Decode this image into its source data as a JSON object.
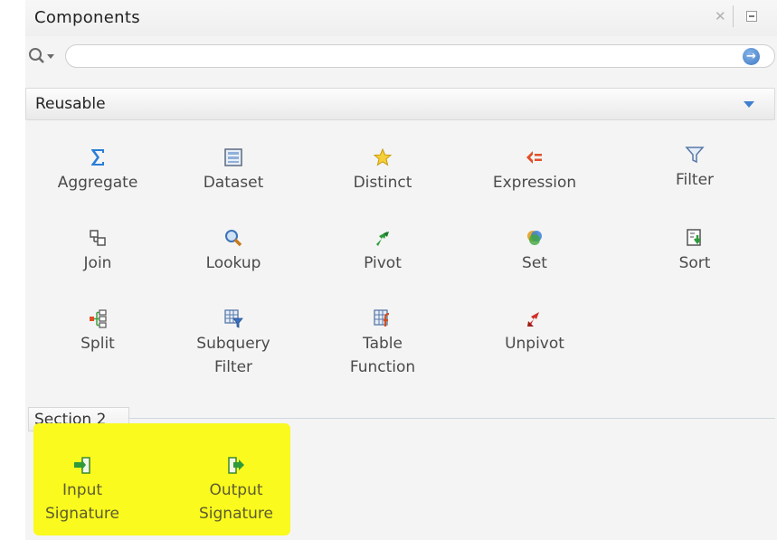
{
  "panel": {
    "title": "Components"
  },
  "search": {
    "placeholder": "",
    "value": ""
  },
  "dropdown": {
    "selected": "Reusable"
  },
  "components": [
    {
      "label": "Aggregate",
      "icon": "sigma-icon"
    },
    {
      "label": "Dataset",
      "icon": "dataset-icon"
    },
    {
      "label": "Distinct",
      "icon": "star-icon"
    },
    {
      "label": "Expression",
      "icon": "expression-icon"
    },
    {
      "label": "Filter",
      "icon": "filter-funnel-icon"
    },
    {
      "label": "Join",
      "icon": "join-icon"
    },
    {
      "label": "Lookup",
      "icon": "magnifier-icon"
    },
    {
      "label": "Pivot",
      "icon": "pivot-arrows-icon"
    },
    {
      "label": "Set",
      "icon": "set-circles-icon"
    },
    {
      "label": "Sort",
      "icon": "sort-icon"
    },
    {
      "label": "Split",
      "icon": "split-icon"
    },
    {
      "label_line1": "Subquery",
      "label_line2": "Filter",
      "icon": "subquery-filter-icon"
    },
    {
      "label_line1": "Table",
      "label_line2": "Function",
      "icon": "table-function-icon"
    },
    {
      "label": "Unpivot",
      "icon": "unpivot-arrows-icon"
    }
  ],
  "section2": {
    "title": "Section 2",
    "items": [
      {
        "label_line1": "Input",
        "label_line2": "Signature",
        "icon": "input-signature-icon"
      },
      {
        "label_line1": "Output",
        "label_line2": "Signature",
        "icon": "output-signature-icon"
      }
    ]
  },
  "colors": {
    "highlight": "#fafa1e",
    "accent": "#3f7fd0"
  }
}
